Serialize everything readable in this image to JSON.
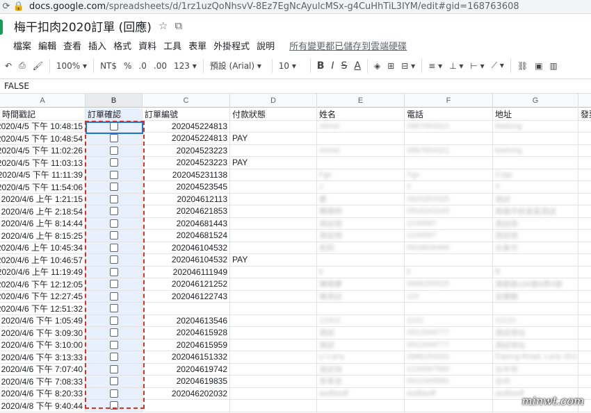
{
  "browser": {
    "url_host": "docs.google.com",
    "url_path": "/spreadsheets/d/1rz1uzQoNhsvV-8Ez7EgNcAyulcMSx-g4CuHhTiL3IYM/edit#gid=168763608"
  },
  "doc": {
    "title": "梅干扣肉2020訂單 (回應)"
  },
  "menu": {
    "items": [
      "檔案",
      "編輯",
      "查看",
      "插入",
      "格式",
      "資料",
      "工具",
      "表單",
      "外掛程式",
      "說明"
    ],
    "saved": "所有變更都已儲存到雲端硬碟"
  },
  "toolbar": {
    "zoom": "100%",
    "currency": "NT$",
    "percent": "%",
    "dec_less": ".0",
    "dec_more": ".00",
    "format": "123",
    "font": "預設 (Arial)",
    "size": "10"
  },
  "formula": {
    "value": "FALSE"
  },
  "columns": [
    "A",
    "B",
    "C",
    "D",
    "E",
    "F",
    "G",
    ""
  ],
  "headers": [
    "時間戳記",
    "訂單確認",
    "訂單編號",
    "付款狀態",
    "姓名",
    "電話",
    "地址",
    "發票"
  ],
  "rows": [
    {
      "a": "2020/4/5 下午 10:48:15",
      "c": "202045224813",
      "d": "",
      "e": "mimei",
      "f": "0987654321",
      "g": "keelung"
    },
    {
      "a": "2020/4/5 下午 10:48:54",
      "c": "202045224813",
      "d": "PAY",
      "e": "",
      "f": "",
      "g": ""
    },
    {
      "a": "2020/4/5 下午 11:02:26",
      "c": "20204523223",
      "d": "",
      "e": "mimei",
      "f": "0987654321",
      "g": "keelung"
    },
    {
      "a": "2020/4/5 下午 11:03:13",
      "c": "20204523223",
      "d": "PAY",
      "e": "",
      "f": "",
      "g": ""
    },
    {
      "a": "2020/4/5 下午 11:11:39",
      "c": "202045231138",
      "d": "",
      "e": "Fgc",
      "f": "Tgx",
      "g": "Cvgx"
    },
    {
      "a": "2020/4/5 下午 11:54:06",
      "c": "20204523545",
      "d": "",
      "e": "1",
      "f": "2",
      "g": "3"
    },
    {
      "a": "2020/4/6 上午 1:21:15",
      "c": "20204612113",
      "d": "",
      "e": "蔡",
      "f": "0925252525",
      "g": "測試"
    },
    {
      "a": "2020/4/6 上午 2:18:54",
      "c": "20204621853",
      "d": "",
      "e": "陳曉明",
      "f": "0918163163",
      "g": "高雄市前金區測試"
    },
    {
      "a": "2020/4/6 上午 8:14:44",
      "c": "20204681443",
      "d": "",
      "e": "測試用",
      "f": "1234567",
      "g": "測試用"
    },
    {
      "a": "2020/4/6 上午 8:15:25",
      "c": "20204681524",
      "d": "",
      "e": "測試用",
      "f": "1234567",
      "g": "測試用"
    },
    {
      "a": "2020/4/6 上午 10:45:34",
      "c": "202046104532",
      "d": "",
      "e": "莉莉",
      "f": "0918636466",
      "g": "台東市"
    },
    {
      "a": "2020/4/6 上午 10:46:57",
      "c": "202046104532",
      "d": "PAY",
      "e": "",
      "f": "",
      "g": ""
    },
    {
      "a": "2020/4/6 上午 11:19:49",
      "c": "202046111949",
      "d": "",
      "e": "ll",
      "f": "ll",
      "g": "lll"
    },
    {
      "a": "2020/4/6 下午 12:12:05",
      "c": "202046121252",
      "d": "",
      "e": "陳曉華",
      "f": "0966250025",
      "g": "港都路168巷8弄8號"
    },
    {
      "a": "2020/4/6 下午 12:27:45",
      "c": "202046122743",
      "d": "",
      "e": "陳測試",
      "f": "110",
      "g": "宜蘭縣"
    },
    {
      "a": "2020/4/6 下午 12:51:32",
      "c": "",
      "d": "",
      "e": "",
      "f": "",
      "g": ""
    },
    {
      "a": "2020/4/6 下午 1:05:49",
      "c": "20204613546",
      "d": "",
      "e": "12312",
      "f": "2121",
      "g": "12121"
    },
    {
      "a": "2020/4/6 下午 3:09:30",
      "c": "20204615928",
      "d": "",
      "e": "測試",
      "f": "0912444777",
      "g": "測試地址"
    },
    {
      "a": "2020/4/6 下午 3:10:00",
      "c": "20204615959",
      "d": "",
      "e": "測試",
      "f": "0912444777",
      "g": "測試地址"
    },
    {
      "a": "2020/4/6 下午 3:13:33",
      "c": "202046151332",
      "d": "",
      "e": "Li Larry",
      "f": "0988154302",
      "g": "Datong Road, Lane 353, 10F"
    },
    {
      "a": "2020/4/6 下午 7:07:40",
      "c": "20204619742",
      "d": "",
      "e": "測試用",
      "f": "1234567890",
      "g": "台中市"
    },
    {
      "a": "2020/4/6 下午 7:08:33",
      "c": "20204619835",
      "d": "",
      "e": "李育丞",
      "f": "0912345681",
      "g": "台中"
    },
    {
      "a": "2020/4/6 下午 8:20:33",
      "c": "202046202032",
      "d": "",
      "e": "asdfasdf",
      "f": "asdfasdf",
      "g": "asdfasdf"
    },
    {
      "a": "2020/4/8 下午 9:40:44",
      "c": "",
      "d": "",
      "e": "",
      "f": "",
      "g": ""
    }
  ],
  "watermark": "minwt.com"
}
